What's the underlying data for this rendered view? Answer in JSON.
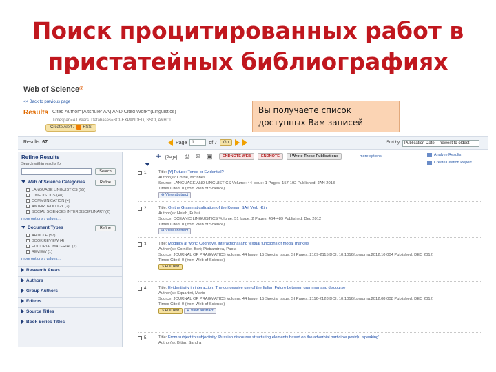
{
  "slide": {
    "title": "Поиск процитированных работ в пристатейных библиографиях"
  },
  "callout": {
    "text": "Вы получаете список доступных Вам записей"
  },
  "header": {
    "logo": "Web of Science",
    "back_link": "<< Back to previous page",
    "results_label": "Results",
    "query": "Cited Author=(Altshuler AA) AND Cited Work=(Linguistics)",
    "query_sub": "Timespan=All Years. Databases=SCI-EXPANDED, SSCI, A&HCI.",
    "alert_label": "Create Alert",
    "rss_label": "RSS"
  },
  "results_bar": {
    "count_label": "Results:",
    "count": "67",
    "page_label": "Page",
    "page_value": "1",
    "of_label": "of 7",
    "go_label": "Go",
    "sort_label": "Sort by:",
    "sort_value": "Publication Date -- newest to oldest"
  },
  "sidebar": {
    "title": "Refine Results",
    "search_within_label": "Search within results for",
    "search_button": "Search",
    "refine_button": "Refine",
    "categories_head": "Web of Science Categories",
    "categories": [
      "LANGUAGE LINGUISTICS (55)",
      "LINGUISTICS (48)",
      "COMMUNICATION (4)",
      "ANTHROPOLOGY (2)",
      "SOCIAL SCIENCES INTERDISCIPLINARY (2)"
    ],
    "more_options": "more options / values...",
    "doctypes_head": "Document Types",
    "doctypes": [
      "ARTICLE (57)",
      "BOOK REVIEW (4)",
      "EDITORIAL MATERIAL (2)",
      "REVIEW (1)"
    ],
    "collapsed": [
      "Research Areas",
      "Authors",
      "Group Authors",
      "Editors",
      "Source Titles",
      "Book Series Titles"
    ]
  },
  "toolbar": {
    "page_label": "Page",
    "endnote_web": "ENDNOTE WEB",
    "endnote": "ENDNOTE",
    "wrote": "I Wrote These Publications",
    "more_options": "more options",
    "analyze": "Analyze Results",
    "citation_report": "Create Citation Report"
  },
  "records": [
    {
      "num": "1.",
      "title_label": "Title:",
      "title": "[Y] Future: Tense or Evidential?",
      "authors": "Author(s): Corrie, McInnes",
      "source": "Source: LANGUAGE AND LINGUISTICS Volume: 44 Issue: 1 Pages: 157-192 Published: JAN 2013",
      "times_cited": "Times Cited: 0 (from Web of Science)",
      "button": "View abstract"
    },
    {
      "num": "2.",
      "title_label": "Title:",
      "title": "On the Grammaticalization of the Korean SAY Verb -Kin",
      "authors": "Author(s): Heiah, Fuhui",
      "source": "Source: OCEANIC LINGUISTICS Volume: 51 Issue: 2 Pages: 464-489 Published: Dec 2012",
      "times_cited": "Times Cited: 0 (from Web of Science)",
      "button": "View abstract"
    },
    {
      "num": "3.",
      "title_label": "Title:",
      "title": "Modality at work: Cognitive, interactional and textual functions of modal markers",
      "authors": "Author(s): Cornillie, Bert; Pietrandrea, Paola",
      "source": "Source: JOURNAL OF PRAGMATICS Volume: 44 Issue: 15 Special Issue: SI Pages: 2109-2115 DOI: 10.1016/j.pragma.2012.10.004 Published: DEC 2012",
      "times_cited": "Times Cited: 0 (from Web of Science)",
      "button": "Full Text"
    },
    {
      "num": "4.",
      "title_label": "Title:",
      "title": "Evidentiality in interaction: The concessive use of the Italian Future between grammar and discourse",
      "authors": "Author(s): Squartini, Mario",
      "source": "Source: JOURNAL OF PRAGMATICS Volume: 44 Issue: 15 Special Issue: SI Pages: 2116-2128 DOI: 10.1016/j.pragma.2012.08.008 Published: DEC 2012",
      "times_cited": "Times Cited: 0 (from Web of Science)",
      "button": "Full Text",
      "button2": "View abstract"
    },
    {
      "num": "5.",
      "title_label": "Title:",
      "title": "From subject to subjectivity: Russian discourse structuring elements based on the adverbial participle povidju 'speaking'",
      "authors": "Author(s): Bittar, Sandra"
    }
  ]
}
